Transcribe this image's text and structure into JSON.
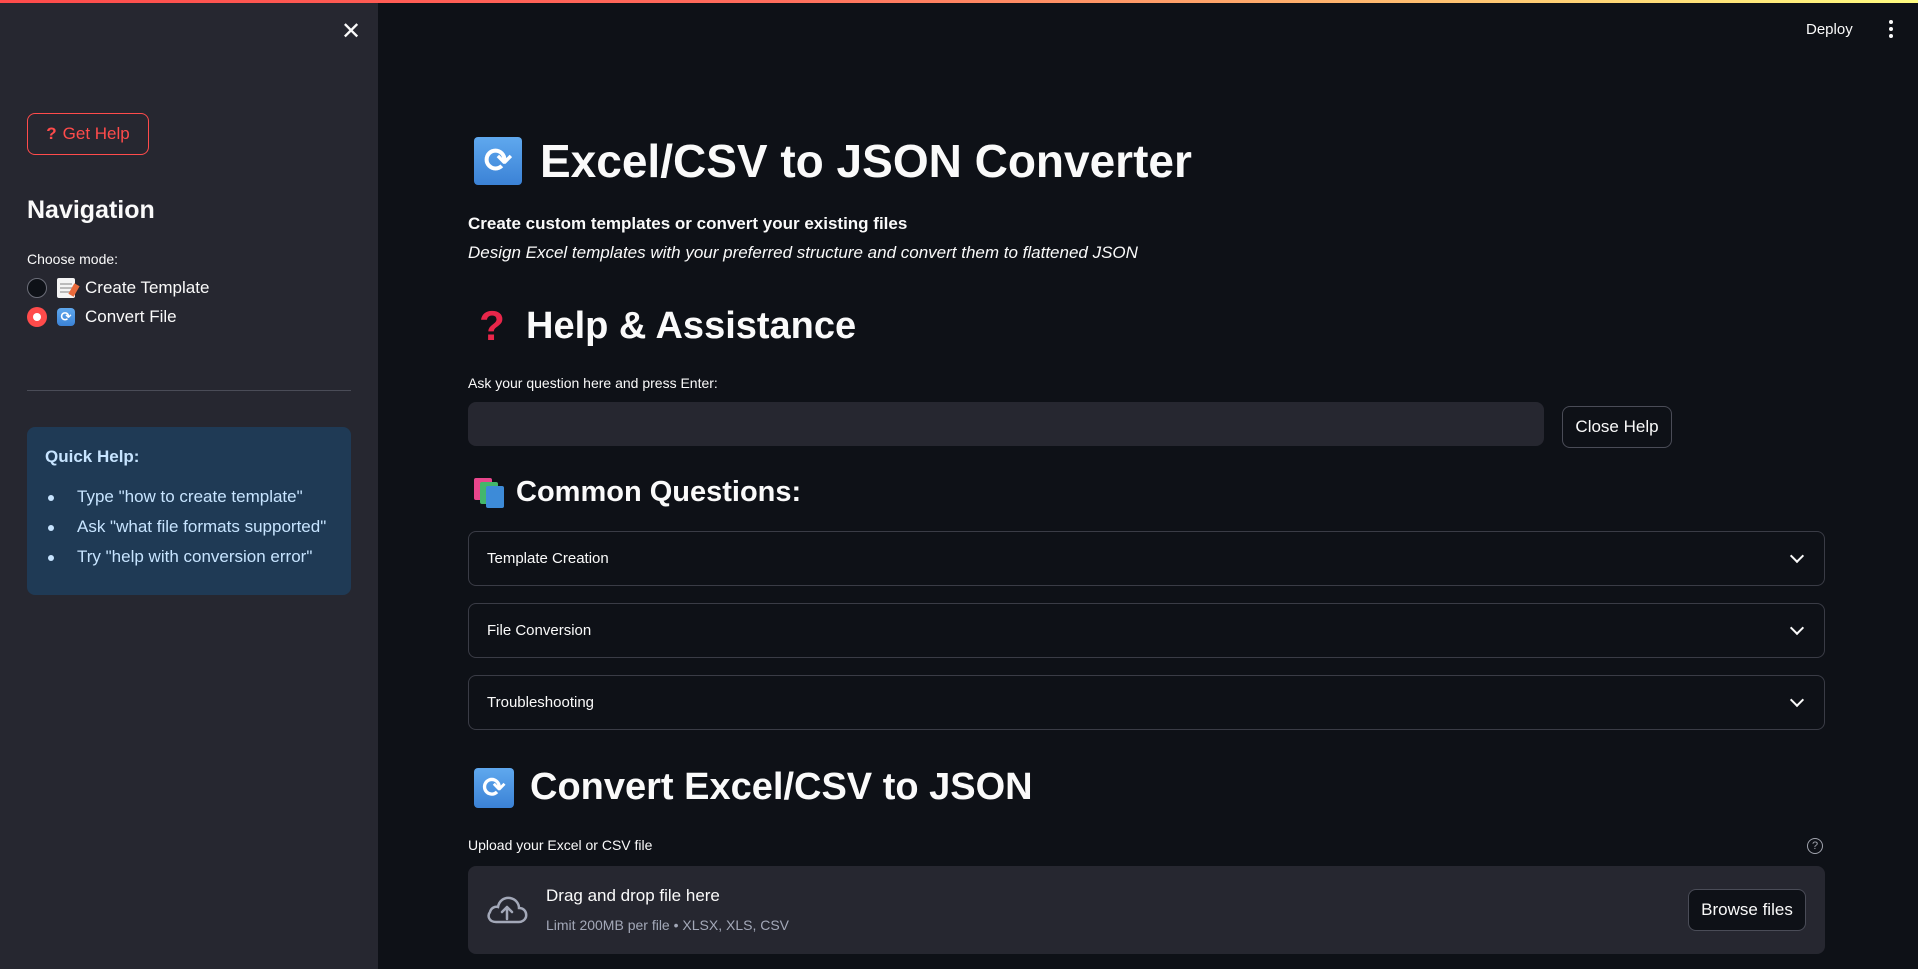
{
  "header": {
    "deploy_label": "Deploy"
  },
  "sidebar": {
    "get_help_label": "Get Help",
    "nav_title": "Navigation",
    "choose_label": "Choose mode:",
    "modes": [
      {
        "label": "Create Template",
        "selected": false,
        "icon": "page-icon"
      },
      {
        "label": "Convert File",
        "selected": true,
        "icon": "arrows-cycle-icon"
      }
    ],
    "quick_help": {
      "title": "Quick Help:",
      "items": [
        "Type \"how to create template\"",
        "Ask \"what file formats supported\"",
        "Try \"help with conversion error\""
      ]
    }
  },
  "main": {
    "title": "Excel/CSV to JSON Converter",
    "subtitle_bold": "Create custom templates or convert your existing files",
    "subtitle_italic": "Design Excel templates with your preferred structure and convert them to flattened JSON",
    "help_section": {
      "title": "Help & Assistance",
      "ask_label": "Ask your question here and press Enter:",
      "input_value": "",
      "close_label": "Close Help"
    },
    "common_questions": {
      "title": "Common Questions:",
      "items": [
        "Template Creation",
        "File Conversion",
        "Troubleshooting"
      ]
    },
    "convert_section": {
      "title": "Convert Excel/CSV to JSON",
      "upload_label": "Upload your Excel or CSV file",
      "drop_text": "Drag and drop file here",
      "limit_text": "Limit 200MB per file • XLSX, XLS, CSV",
      "browse_label": "Browse files"
    }
  },
  "colors": {
    "background": "#0e1117",
    "sidebar": "#262730",
    "accent": "#ff4b4b",
    "info_box": "#1f3a55"
  }
}
